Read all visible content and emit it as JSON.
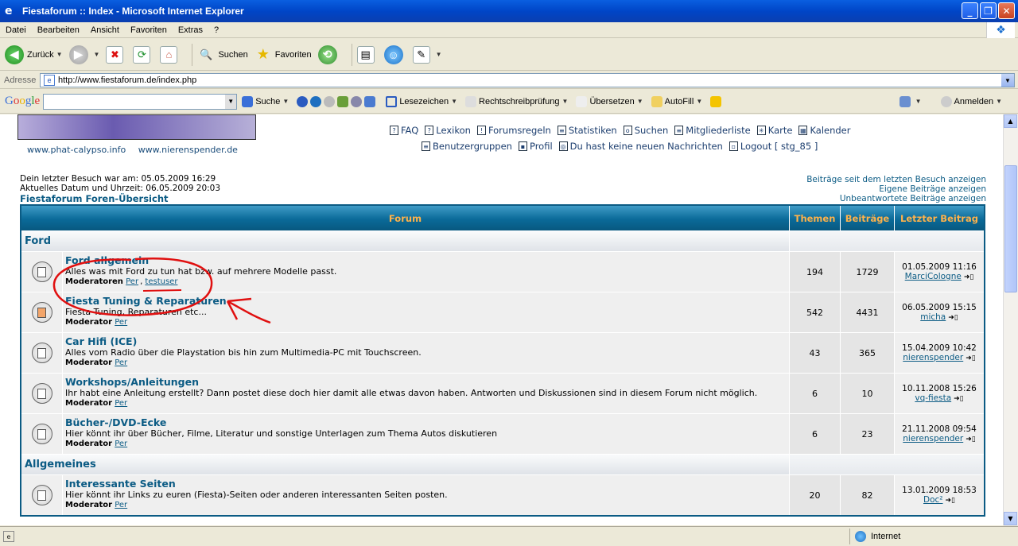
{
  "window": {
    "title": "Fiestaforum :: Index - Microsoft Internet Explorer",
    "minimize": "_",
    "maximize": "❐",
    "close": "✕"
  },
  "menu": [
    "Datei",
    "Bearbeiten",
    "Ansicht",
    "Favoriten",
    "Extras",
    "?"
  ],
  "toolbar": {
    "back": "Zurück",
    "search": "Suchen",
    "favorites": "Favoriten"
  },
  "address": {
    "label": "Adresse",
    "url": "http://www.fiestaforum.de/index.php"
  },
  "googlebar": {
    "logo": "Google",
    "search": "Suche",
    "bookmarks": "Lesezeichen",
    "spellcheck": "Rechtschreibprüfung",
    "translate": "Übersetzen",
    "autofill": "AutoFill",
    "login": "Anmelden"
  },
  "partners": [
    "www.phat-calypso.info",
    "www.nierenspender.de"
  ],
  "nav1": [
    "FAQ",
    "Lexikon",
    "Forumsregeln",
    "Statistiken",
    "Suchen",
    "Mitgliederliste",
    "Karte",
    "Kalender"
  ],
  "nav2": [
    "Benutzergruppen",
    "Profil",
    "Du hast keine neuen Nachrichten",
    "Logout [ stg_85 ]"
  ],
  "visit": {
    "last": "Dein letzter Besuch war am: 05.05.2009 16:29",
    "current": "Aktuelles Datum und Uhrzeit: 06.05.2009 20:03",
    "index": "Fiestaforum Foren-Übersicht"
  },
  "right_links": [
    "Beiträge seit dem letzten Besuch anzeigen",
    "Eigene Beiträge anzeigen",
    "Unbeantwortete Beiträge anzeigen"
  ],
  "table": {
    "headers": {
      "forum": "Forum",
      "themen": "Themen",
      "beitraege": "Beiträge",
      "letzter": "Letzter Beitrag"
    },
    "categories": [
      {
        "name": "Ford",
        "forums": [
          {
            "name": "Ford allgemein",
            "desc": "Alles was mit Ford zu tun hat bzw. auf mehrere Modelle passt.",
            "modlabel": "Moderatoren",
            "mods": [
              "Per",
              "testuser"
            ],
            "themen": "194",
            "beitraege": "1729",
            "date": "01.05.2009 11:16",
            "user": "MarciCologne",
            "isNew": false
          },
          {
            "name": "Fiesta Tuning & Reparaturen",
            "desc": "Fiesta Tuning, Reparaturen etc...",
            "modlabel": "Moderator",
            "mods": [
              "Per"
            ],
            "themen": "542",
            "beitraege": "4431",
            "date": "06.05.2009 15:15",
            "user": "micha",
            "isNew": true
          },
          {
            "name": "Car Hifi (ICE)",
            "desc": "Alles vom Radio über die Playstation bis hin zum Multimedia-PC mit Touchscreen.",
            "modlabel": "Moderator",
            "mods": [
              "Per"
            ],
            "themen": "43",
            "beitraege": "365",
            "date": "15.04.2009 10:42",
            "user": "nierenspender",
            "isNew": false
          },
          {
            "name": "Workshops/Anleitungen",
            "desc": "Ihr habt eine Anleitung erstellt? Dann postet diese doch hier damit alle etwas davon haben. Antworten und Diskussionen sind in diesem Forum nicht möglich.",
            "modlabel": "Moderator",
            "mods": [
              "Per"
            ],
            "themen": "6",
            "beitraege": "10",
            "date": "10.11.2008 15:26",
            "user": "vq-fiesta",
            "isNew": false
          },
          {
            "name": "Bücher-/DVD-Ecke",
            "desc": "Hier könnt ihr über Bücher, Filme, Literatur und sonstige Unterlagen zum Thema Autos diskutieren",
            "modlabel": "Moderator",
            "mods": [
              "Per"
            ],
            "themen": "6",
            "beitraege": "23",
            "date": "21.11.2008 09:54",
            "user": "nierenspender",
            "isNew": false
          }
        ]
      },
      {
        "name": "Allgemeines",
        "forums": [
          {
            "name": "Interessante Seiten",
            "desc": "Hier könnt ihr Links zu euren (Fiesta)-Seiten oder anderen interessanten Seiten posten.",
            "modlabel": "Moderator",
            "mods": [
              "Per"
            ],
            "themen": "20",
            "beitraege": "82",
            "date": "13.01.2009 18:53",
            "user": "Doc²",
            "isNew": false
          }
        ]
      }
    ]
  },
  "status": {
    "zone": "Internet"
  },
  "colors": {
    "accent": "#0b5b84",
    "header_text": "#ffb24a",
    "annotation": "#e01010"
  }
}
